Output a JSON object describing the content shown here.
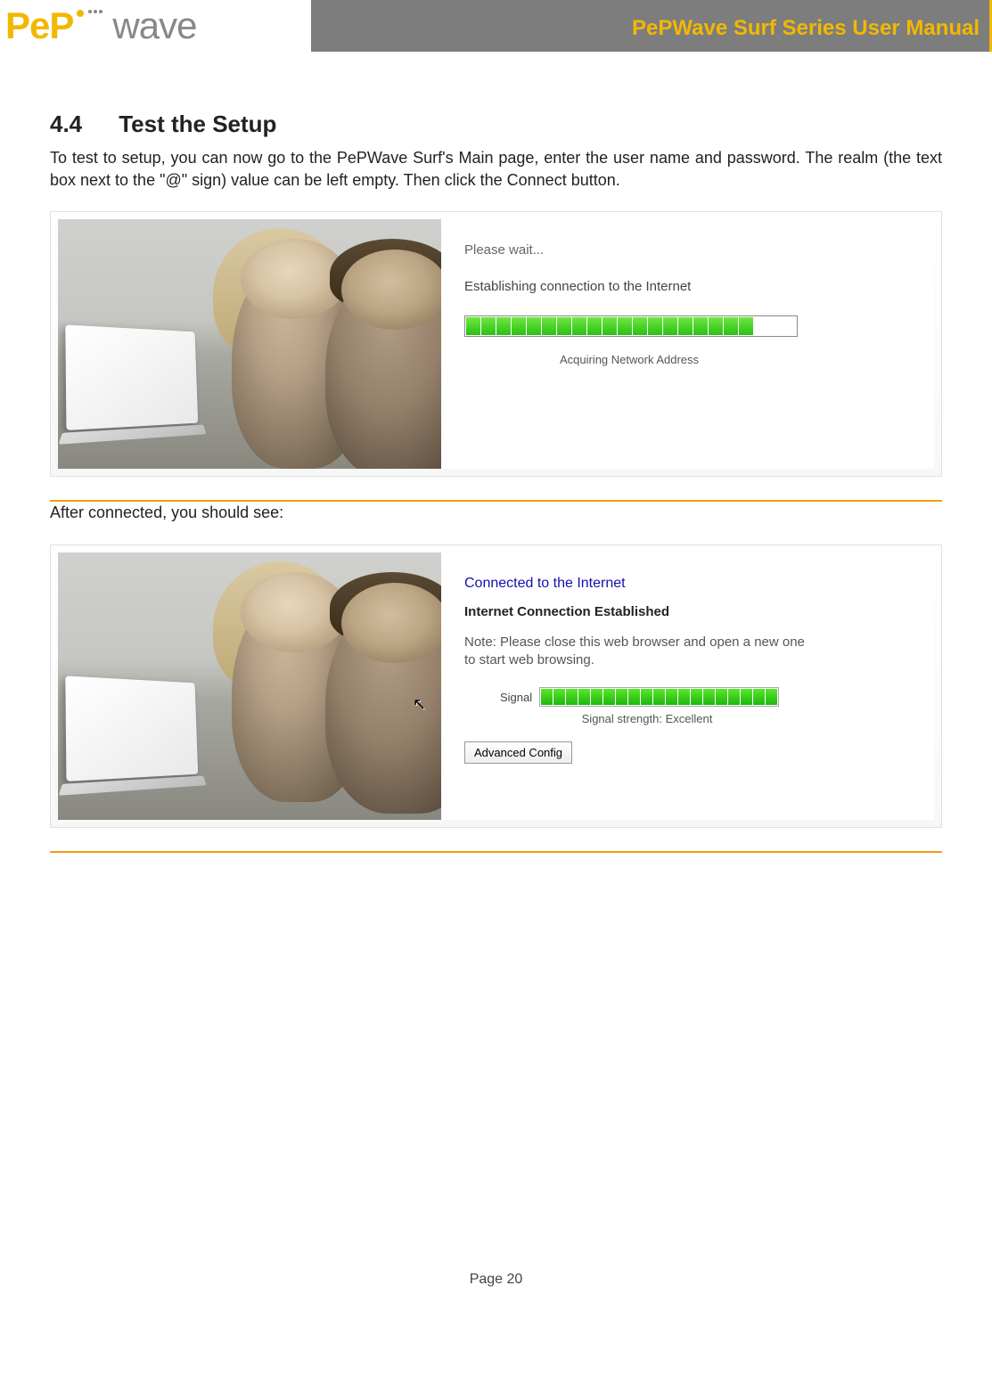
{
  "header": {
    "logo_pep": "PeP",
    "logo_wave": "wave",
    "title": "PePWave Surf Series User Manual"
  },
  "section": {
    "number": "4.4",
    "title": "Test the Setup",
    "para1": "To test to setup, you can now go to the PePWave Surf's Main page, enter the user name and password.  The realm (the text box next to the \"@\" sign) value can be left empty.  Then click the Connect button.",
    "para2": "After connected, you should see:"
  },
  "shot1": {
    "wait": "Please wait...",
    "establishing": "Establishing connection to the Internet",
    "acquiring": "Acquiring Network Address",
    "progress_segments": 19
  },
  "shot2": {
    "connected": "Connected to the Internet",
    "established": "Internet Connection Established",
    "note": "Note: Please close this web browser and open a new one to start web browsing.",
    "signal_label": "Signal",
    "signal_segments": 19,
    "signal_text": "Signal strength: Excellent",
    "adv_button": "Advanced Config"
  },
  "footer": {
    "page": "Page 20"
  }
}
